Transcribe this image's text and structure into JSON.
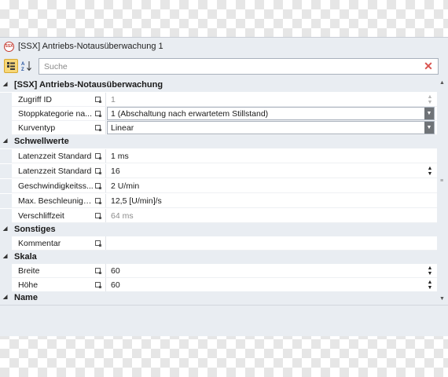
{
  "window": {
    "title": "[SSX] Antriebs-Notausüberwachung 1",
    "icon": "ssx-logo-icon"
  },
  "toolbar": {
    "categorized_icon": "categorized-icon",
    "sort_icon": "sort-az-icon",
    "search_placeholder": "Suche",
    "clear_icon": "✕"
  },
  "groups": [
    {
      "label": "[SSX] Antriebs-Notausüberwachung",
      "rows": [
        {
          "name": "Zugriff ID",
          "value": "1",
          "state": "disabled",
          "spinner": true
        },
        {
          "name": "Stoppkategorie na...",
          "value": "1 (Abschaltung nach erwartetem Stillstand)",
          "editor": "combo"
        },
        {
          "name": "Kurventyp",
          "value": "Linear",
          "editor": "combo"
        }
      ]
    },
    {
      "label": "Schwellwerte",
      "rows": [
        {
          "name": "Latenzzeit Standard",
          "value": "1 ms"
        },
        {
          "name": "Latenzzeit Standard",
          "value": "16",
          "spinner": true
        },
        {
          "name": "Geschwindigkeitss...",
          "value": "2 U/min"
        },
        {
          "name": "Max. Beschleunigu...",
          "value": "12,5 [U/min]/s"
        },
        {
          "name": "Verschliffzeit",
          "value": "64 ms",
          "state": "disabled"
        }
      ]
    },
    {
      "label": "Sonstiges",
      "rows": [
        {
          "name": "Kommentar",
          "value": ""
        }
      ]
    },
    {
      "label": "Skala",
      "rows": [
        {
          "name": "Breite",
          "value": "60",
          "spinner": true
        },
        {
          "name": "Höhe",
          "value": "60",
          "spinner": true
        }
      ]
    },
    {
      "label": "Name",
      "rows": []
    }
  ],
  "colors": {
    "panel_bg": "#e9edf2",
    "accent_red": "#d9534f",
    "category_button": "#f7d778"
  }
}
